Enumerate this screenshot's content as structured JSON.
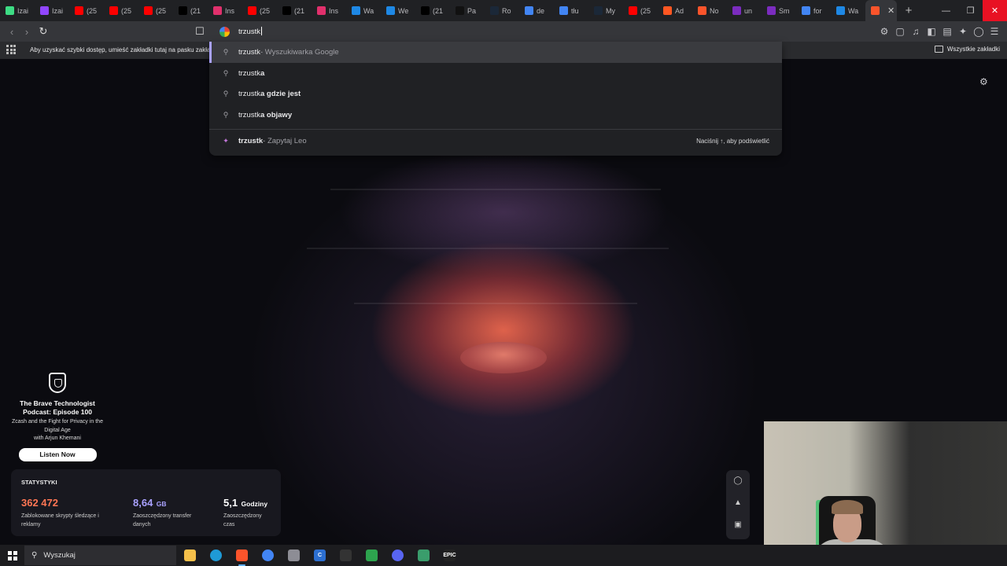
{
  "tabs": [
    {
      "label": "Izai",
      "icon": "tab-app-icon",
      "color": "#3ddc84"
    },
    {
      "label": "Izai",
      "icon": "twitch-icon",
      "color": "#9146ff"
    },
    {
      "label": "(25",
      "icon": "youtube-icon",
      "color": "#ff0000"
    },
    {
      "label": "(25",
      "icon": "youtube-icon",
      "color": "#ff0000"
    },
    {
      "label": "(25",
      "icon": "youtube-icon",
      "color": "#ff0000"
    },
    {
      "label": "(21",
      "icon": "x-icon",
      "color": "#000000"
    },
    {
      "label": "Ins",
      "icon": "instagram-icon",
      "color": "#e1306c"
    },
    {
      "label": "(25",
      "icon": "youtube-icon",
      "color": "#ff0000"
    },
    {
      "label": "(21",
      "icon": "x-icon",
      "color": "#000000"
    },
    {
      "label": "Ins",
      "icon": "instagram-icon",
      "color": "#e1306c"
    },
    {
      "label": "Wa",
      "icon": "web-icon",
      "color": "#1e88e5"
    },
    {
      "label": "We",
      "icon": "web-icon",
      "color": "#1e88e5"
    },
    {
      "label": "(21",
      "icon": "x-icon",
      "color": "#000000"
    },
    {
      "label": "Pa",
      "icon": "tiktok-icon",
      "color": "#111111"
    },
    {
      "label": "Ro",
      "icon": "steam-icon",
      "color": "#1b2838"
    },
    {
      "label": "de",
      "icon": "google-icon",
      "color": "#4285f4"
    },
    {
      "label": "tłu",
      "icon": "google-icon",
      "color": "#4285f4"
    },
    {
      "label": "My",
      "icon": "steam-icon",
      "color": "#1b2838"
    },
    {
      "label": "(25",
      "icon": "youtube-icon",
      "color": "#ff0000"
    },
    {
      "label": "Ad",
      "icon": "fire-icon",
      "color": "#ff5722"
    },
    {
      "label": "No",
      "icon": "brave-icon",
      "color": "#fb542b"
    },
    {
      "label": "un",
      "icon": "app-icon",
      "color": "#7b2cbf"
    },
    {
      "label": "Sm",
      "icon": "app-icon",
      "color": "#7b2cbf"
    },
    {
      "label": "for",
      "icon": "google-icon",
      "color": "#4285f4"
    },
    {
      "label": "Wa",
      "icon": "web-icon",
      "color": "#1e88e5"
    }
  ],
  "omnibox": {
    "typed": "trzustk"
  },
  "bookmarks": {
    "hint": "Aby uzyskać szybki dostęp, umieść zakładki tutaj na pasku zakładek.",
    "all_label": "Wszystkie zakładki"
  },
  "suggestions": [
    {
      "typed": "trzustk",
      "completion": "",
      "suffix": " - Wyszukiwarka Google"
    },
    {
      "typed": "trzustk",
      "completion": "a",
      "suffix": ""
    },
    {
      "typed": "trzustk",
      "completion": "a gdzie jest",
      "suffix": ""
    },
    {
      "typed": "trzustk",
      "completion": "a objawy",
      "suffix": ""
    }
  ],
  "leo": {
    "query": "trzustk",
    "suffix": " - Zapytaj Leo",
    "hint": "Naciśnij ↑, aby podświetlić"
  },
  "podcast": {
    "title": "The Brave Technologist Podcast: Episode 100",
    "subtitle": "Zcash and the Fight for Privacy in the Digital Age",
    "guest": "with Arjun Khemani",
    "button": "Listen Now"
  },
  "stats": {
    "header": "STATYSTYKI",
    "items": [
      {
        "value": "362 472",
        "unit": "",
        "label": "Zablokowane skrypty śledzące i reklamy",
        "color": "#ff7654"
      },
      {
        "value": "8,64",
        "unit": "GB",
        "label": "Zaoszczędzony transfer danych",
        "color": "#a9a1ff"
      },
      {
        "value": "5,1",
        "unit": "Godziny",
        "label": "Zaoszczędzony czas",
        "color": "#ffffff"
      }
    ]
  },
  "taskbar": {
    "search_placeholder": "Wyszukaj",
    "apps": [
      {
        "name": "file-explorer-icon",
        "color": "#f5c04a",
        "glyph": ""
      },
      {
        "name": "edge-icon",
        "color": "#1f9ad6",
        "glyph": ""
      },
      {
        "name": "brave-icon",
        "color": "#fb542b",
        "glyph": ""
      },
      {
        "name": "chrome-icon",
        "color": "#4285f4",
        "glyph": ""
      },
      {
        "name": "app-icon",
        "color": "#8d8d95",
        "glyph": ""
      },
      {
        "name": "ccleaner-icon",
        "color": "#2c6fd1",
        "glyph": "C"
      },
      {
        "name": "recorder-icon",
        "color": "#333333",
        "glyph": ""
      },
      {
        "name": "play-icon",
        "color": "#2da44e",
        "glyph": ""
      },
      {
        "name": "discord-icon",
        "color": "#5865f2",
        "glyph": ""
      },
      {
        "name": "chart-app-icon",
        "color": "#3a9d6c",
        "glyph": ""
      },
      {
        "name": "epic-games-icon",
        "color": "#222222",
        "glyph": "EPIC"
      }
    ]
  }
}
